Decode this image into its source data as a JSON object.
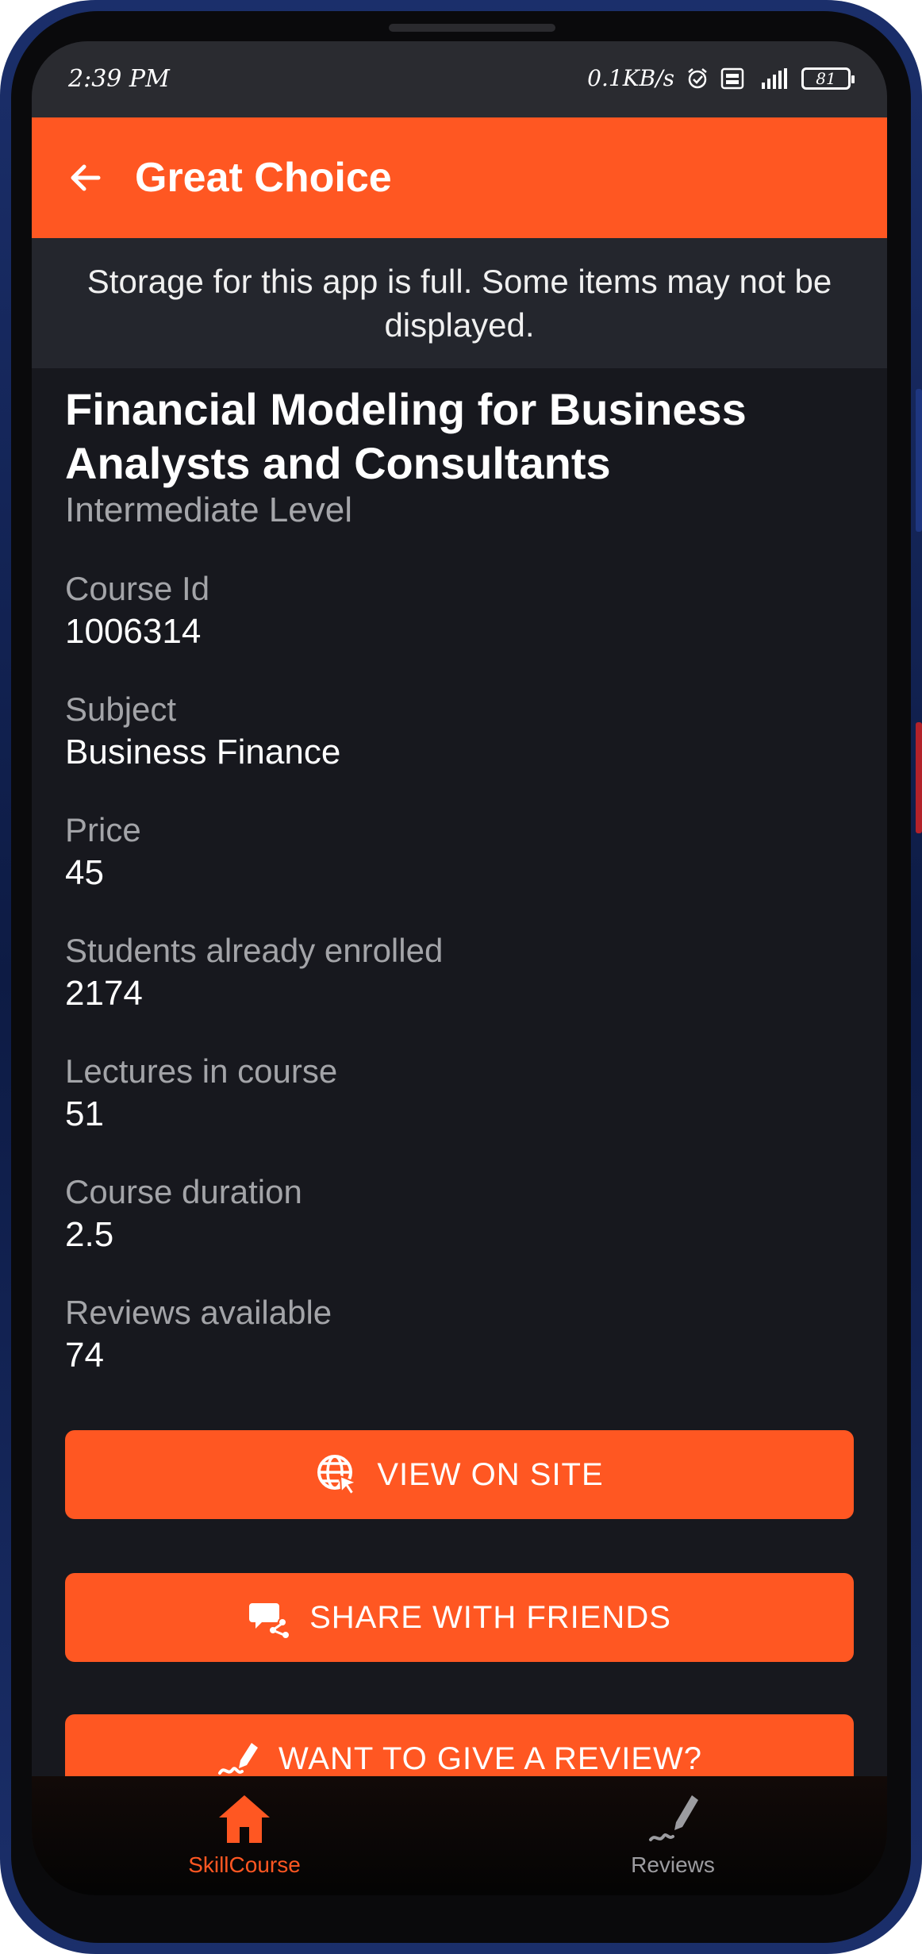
{
  "status_bar": {
    "time": "2:39 PM",
    "network_speed": "0.1KB/s",
    "battery": "81",
    "icons": [
      "alarm-icon",
      "volte-icon",
      "signal-4g-icon",
      "battery-icon"
    ]
  },
  "app_bar": {
    "title": "Great Choice",
    "back_icon": "arrow-left-icon"
  },
  "banner": {
    "text": "Storage for this app is full. Some items may not be displayed."
  },
  "course": {
    "title": "Financial Modeling for Business Analysts and Consultants",
    "level": "Intermediate Level",
    "fields": [
      {
        "label": "Course Id",
        "value": "1006314"
      },
      {
        "label": "Subject",
        "value": "Business Finance"
      },
      {
        "label": "Price",
        "value": "45"
      },
      {
        "label": "Students already enrolled",
        "value": "2174"
      },
      {
        "label": "Lectures in course",
        "value": "51"
      },
      {
        "label": "Course duration",
        "value": "2.5"
      },
      {
        "label": "Reviews available",
        "value": "74"
      }
    ]
  },
  "actions": {
    "view_on_site": {
      "label": "VIEW ON SITE",
      "icon": "globe-cursor-icon"
    },
    "share": {
      "label": "SHARE WITH FRIENDS",
      "icon": "chat-share-icon"
    },
    "review": {
      "label": "WANT TO GIVE A REVIEW?",
      "icon": "signature-pen-icon"
    }
  },
  "bottom_nav": {
    "items": [
      {
        "label": "SkillCourse",
        "icon": "home-icon",
        "active": true
      },
      {
        "label": "Reviews",
        "icon": "pen-icon",
        "active": false
      }
    ]
  },
  "colors": {
    "accent": "#ff5722",
    "background": "#17181e",
    "banner": "#24262d",
    "label": "#a3a4a8"
  }
}
